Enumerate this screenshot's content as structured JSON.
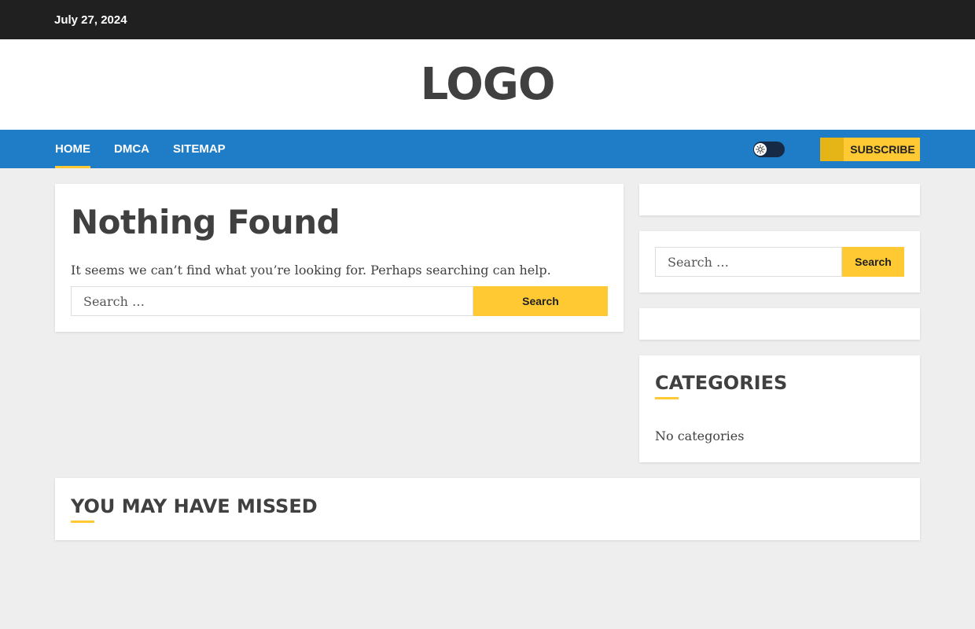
{
  "topbar": {
    "date": "July 27, 2024"
  },
  "branding": {
    "logo_text": "LOGO"
  },
  "nav": {
    "items": [
      {
        "label": "HOME",
        "active": true
      },
      {
        "label": "DMCA",
        "active": false
      },
      {
        "label": "SITEMAP",
        "active": false
      }
    ],
    "subscribe_label": "SUBSCRIBE",
    "theme_toggle_icon": "sun-icon"
  },
  "main": {
    "title": "Nothing Found",
    "message": "It seems we can’t find what you’re looking for. Perhaps searching can help.",
    "search": {
      "placeholder": "Search …",
      "button_label": "Search"
    }
  },
  "sidebar": {
    "search": {
      "placeholder": "Search …",
      "button_label": "Search"
    },
    "categories": {
      "title": "Categories",
      "empty_text": "No categories"
    }
  },
  "missed": {
    "title": "You May Have Missed"
  },
  "colors": {
    "accent": "#ffc934",
    "nav": "#1f7cc7",
    "topbar": "#202020"
  }
}
